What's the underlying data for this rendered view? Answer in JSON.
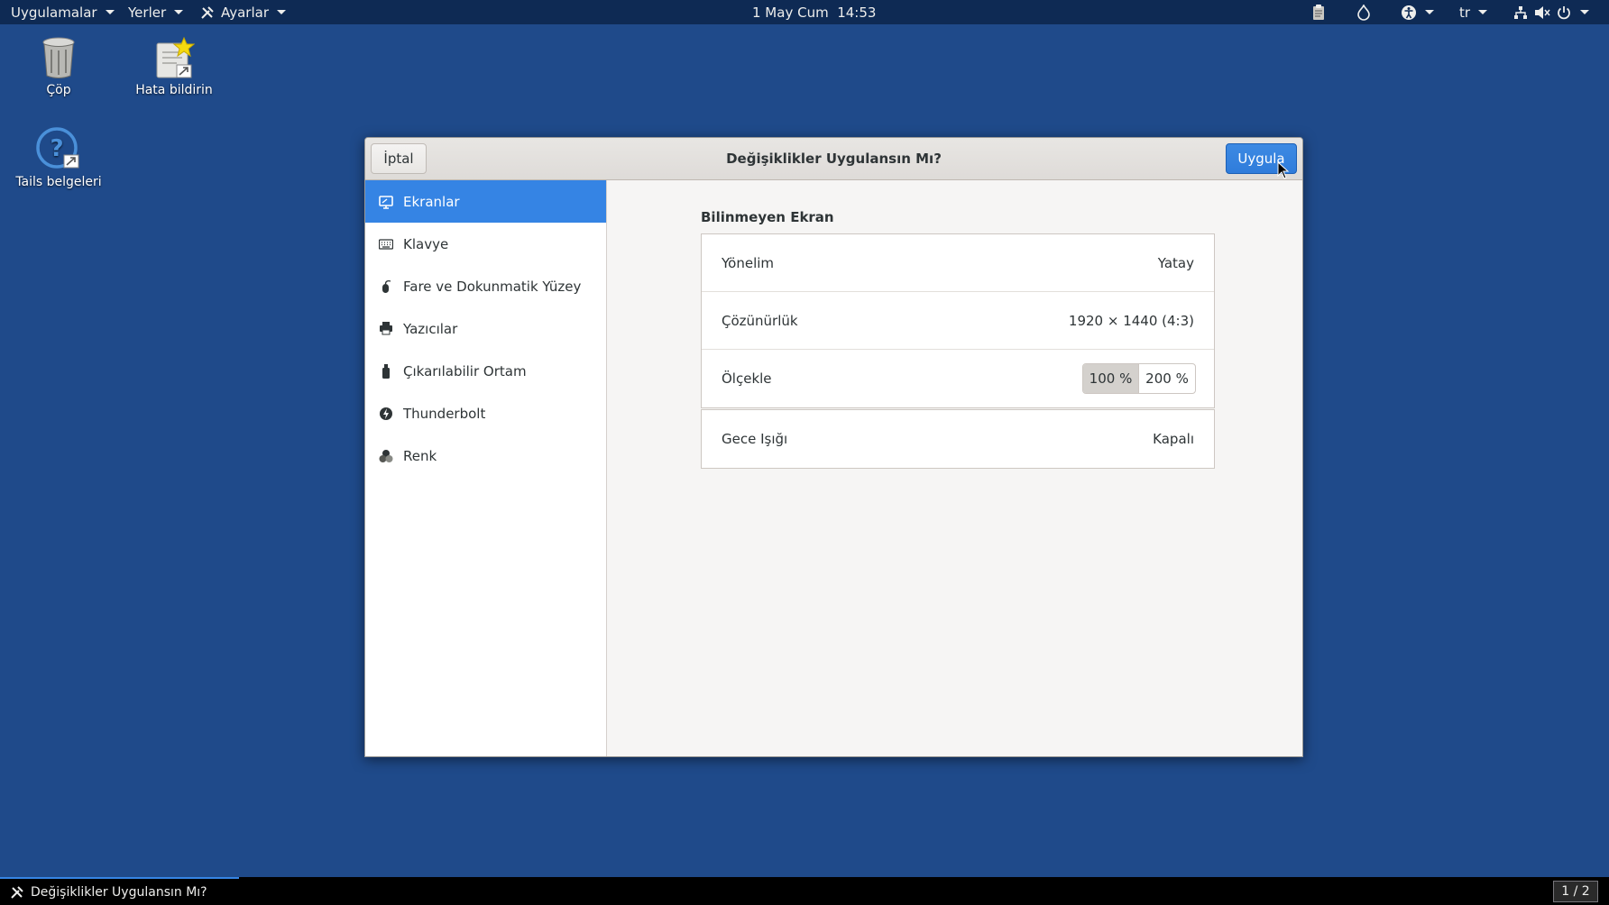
{
  "topbar": {
    "applications": "Uygulamalar",
    "places": "Yerler",
    "settings": "Ayarlar",
    "datetime": "1 May Cum  14:53",
    "language": "tr"
  },
  "desktop": {
    "icons": [
      {
        "label": "Çöp",
        "icon": "trash-icon"
      },
      {
        "label": "Hata bildirin",
        "icon": "bug-report-icon"
      },
      {
        "label": "Tails belgeleri",
        "icon": "help-icon"
      }
    ]
  },
  "window": {
    "title": "Değişiklikler Uygulansın Mı?",
    "cancel_label": "İptal",
    "apply_label": "Uygula",
    "accent": "#3584e4"
  },
  "sidebar": {
    "items": [
      {
        "label": "Ekranlar",
        "icon": "display-icon"
      },
      {
        "label": "Klavye",
        "icon": "keyboard-icon"
      },
      {
        "label": "Fare ve Dokunmatik Yüzey",
        "icon": "mouse-icon"
      },
      {
        "label": "Yazıcılar",
        "icon": "printer-icon"
      },
      {
        "label": "Çıkarılabilir Ortam",
        "icon": "removable-media-icon"
      },
      {
        "label": "Thunderbolt",
        "icon": "thunderbolt-icon"
      },
      {
        "label": "Renk",
        "icon": "color-icon"
      }
    ],
    "selected": "Ekranlar"
  },
  "display": {
    "heading": "Bilinmeyen Ekran",
    "orientation_label": "Yönelim",
    "orientation_value": "Yatay",
    "resolution_label": "Çözünürlük",
    "resolution_value": "1920 × 1440 (4:3)",
    "scale_label": "Ölçekle",
    "scale_options": [
      "100 %",
      "200 %"
    ],
    "scale_selected": "100 %",
    "night_light_label": "Gece Işığı",
    "night_light_value": "Kapalı"
  },
  "taskbar": {
    "window_title": "Değişiklikler Uygulansın Mı?",
    "workspace": "1 / 2"
  }
}
